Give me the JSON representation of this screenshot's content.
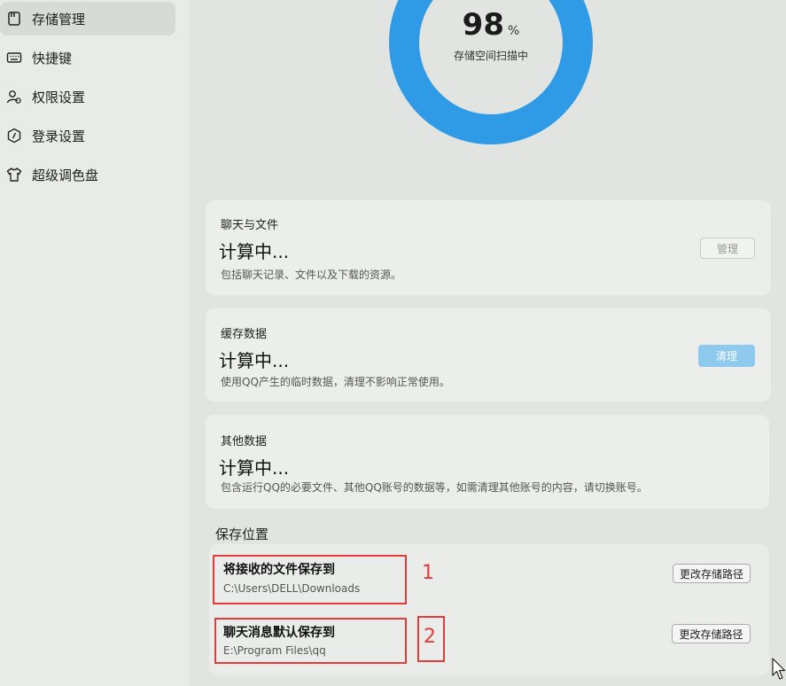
{
  "sidebar": {
    "items": [
      {
        "label": "存储管理",
        "icon": "storage-icon",
        "active": true
      },
      {
        "label": "快捷键",
        "icon": "keyboard-icon",
        "active": false
      },
      {
        "label": "权限设置",
        "icon": "user-permission-icon",
        "active": false
      },
      {
        "label": "登录设置",
        "icon": "shield-icon",
        "active": false
      },
      {
        "label": "超级调色盘",
        "icon": "tshirt-icon",
        "active": false
      }
    ]
  },
  "scan": {
    "percent": "98",
    "unit": "%",
    "label": "存储空间扫描中",
    "ring_color": "#2f9be6"
  },
  "cards": [
    {
      "title": "聊天与文件",
      "value": "计算中...",
      "desc": "包括聊天记录、文件以及下载的资源。",
      "button": "管理"
    },
    {
      "title": "缓存数据",
      "value": "计算中...",
      "desc": "使用QQ产生的临时数据，清理不影响正常使用。",
      "button": "清理"
    },
    {
      "title": "其他数据",
      "value": "计算中...",
      "desc": "包含运行QQ的必要文件、其他QQ账号的数据等，如需清理其他账号的内容，请切换账号。"
    }
  ],
  "save_location": {
    "section_title": "保存位置",
    "rows": [
      {
        "title": "将接收的文件保存到",
        "path": "C:\\Users\\DELL\\Downloads",
        "button": "更改存储路径"
      },
      {
        "title": "聊天消息默认保存到",
        "path": "E:\\Program Files\\qq",
        "button": "更改存储路径"
      }
    ]
  },
  "annotations": [
    "1",
    "2"
  ],
  "colors": {
    "annotation": "#e23b3b",
    "accent": "#2f9be6",
    "primary_button": "#8ec9ee"
  }
}
